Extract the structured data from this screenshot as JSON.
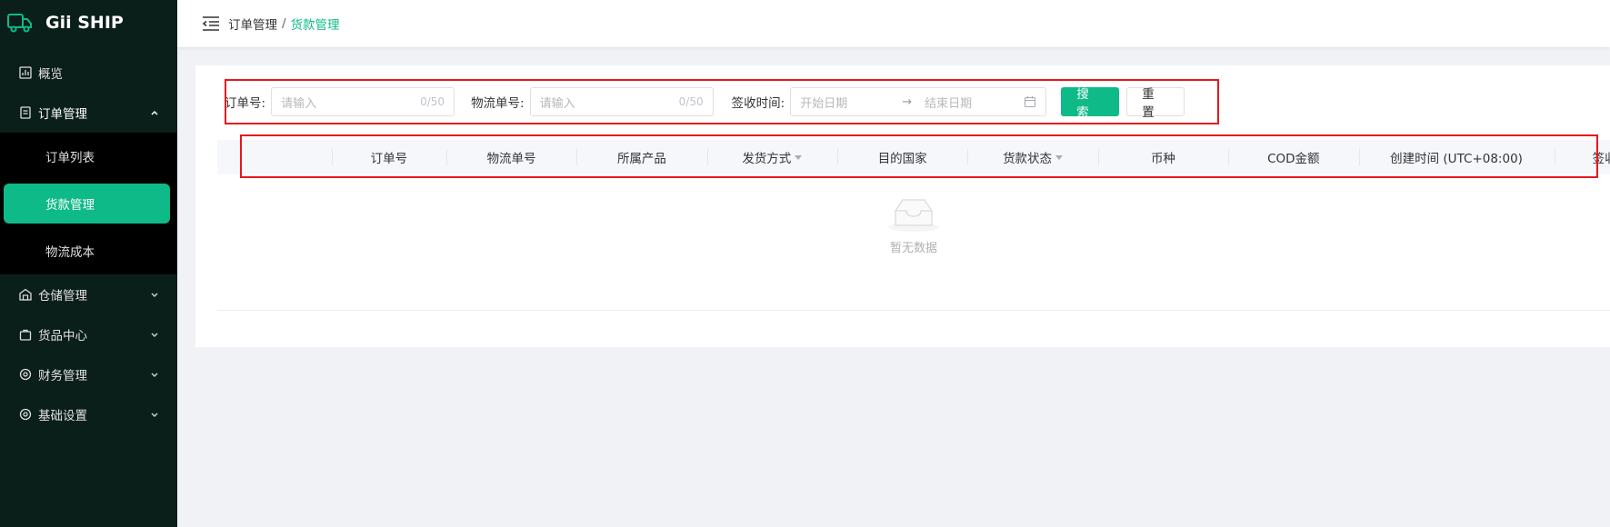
{
  "app": {
    "title": "Gii SHIP"
  },
  "sidebar": {
    "items": [
      {
        "label": "概览",
        "icon": "dashboard-icon"
      },
      {
        "label": "订单管理",
        "icon": "order-icon",
        "expanded": true,
        "children": [
          {
            "label": "订单列表"
          },
          {
            "label": "货款管理",
            "active": true
          },
          {
            "label": "物流成本"
          }
        ]
      },
      {
        "label": "仓储管理",
        "icon": "warehouse-icon"
      },
      {
        "label": "货品中心",
        "icon": "goods-icon"
      },
      {
        "label": "财务管理",
        "icon": "finance-gear-icon"
      },
      {
        "label": "基础设置",
        "icon": "settings-gear-icon"
      }
    ]
  },
  "header": {
    "breadcrumb": {
      "parent": "订单管理",
      "separator": "/",
      "current": "货款管理"
    }
  },
  "filters": {
    "order_no": {
      "label": "订单号:",
      "placeholder": "请输入",
      "count": "0/50"
    },
    "tracking_no": {
      "label": "物流单号:",
      "placeholder": "请输入",
      "count": "0/50"
    },
    "sign_time": {
      "label": "签收时间:",
      "start_placeholder": "开始日期",
      "arrow": "→",
      "end_placeholder": "结束日期"
    },
    "search_label": "搜索",
    "reset_label": "重置"
  },
  "table": {
    "columns": [
      {
        "label": "订单号"
      },
      {
        "label": "物流单号"
      },
      {
        "label": "所属产品"
      },
      {
        "label": "发货方式",
        "filter": true
      },
      {
        "label": "目的国家"
      },
      {
        "label": "货款状态",
        "filter": true
      },
      {
        "label": "币种"
      },
      {
        "label": "COD金额"
      },
      {
        "label": "创建时间 (UTC+08:00)"
      },
      {
        "label": "签收时间 (UTC"
      }
    ],
    "empty_text": "暂无数据"
  },
  "colors": {
    "accent": "#0dba88",
    "sidebar_bg": "#0b1f1a",
    "highlight": "#e5181e"
  }
}
